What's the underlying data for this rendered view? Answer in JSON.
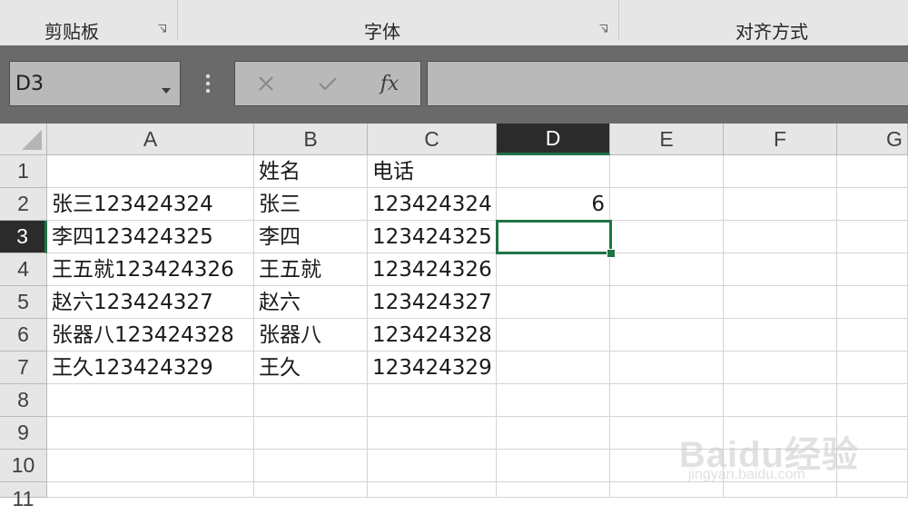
{
  "ribbon": {
    "groups": [
      {
        "label": "剪贴板"
      },
      {
        "label": "字体"
      },
      {
        "label": "对齐方式"
      }
    ]
  },
  "formula_bar": {
    "name_box": "D3",
    "cancel_icon": "close-icon",
    "enter_icon": "check-icon",
    "fx_label": "fx",
    "formula": ""
  },
  "sheet": {
    "columns": [
      "A",
      "B",
      "C",
      "D",
      "E",
      "F",
      "G"
    ],
    "selected_column": "D",
    "rows": [
      "1",
      "2",
      "3",
      "4",
      "5",
      "6",
      "7",
      "8",
      "9",
      "10",
      "11"
    ],
    "selected_row": "3",
    "active_cell": "D3",
    "cells": {
      "r1": {
        "A": "",
        "B": "姓名",
        "C": "电话",
        "D": ""
      },
      "r2": {
        "A": "张三123424324",
        "B": "张三",
        "C": "123424324",
        "D": "6"
      },
      "r3": {
        "A": "李四123424325",
        "B": "李四",
        "C": "123424325",
        "D": ""
      },
      "r4": {
        "A": "王五就123424326",
        "B": "王五就",
        "C": "123424326",
        "D": ""
      },
      "r5": {
        "A": "赵六123424327",
        "B": "赵六",
        "C": "123424327",
        "D": ""
      },
      "r6": {
        "A": "张器八123424328",
        "B": "张器八",
        "C": "123424328",
        "D": ""
      },
      "r7": {
        "A": "王久123424329",
        "B": "王久",
        "C": "123424329",
        "D": ""
      }
    }
  },
  "watermark": {
    "main": "Baidu经验",
    "sub": "jingyan.baidu.com"
  },
  "colors": {
    "accent": "#217346",
    "header_bg": "#e6e6e6",
    "selected_header_bg": "#2b2b2b"
  }
}
